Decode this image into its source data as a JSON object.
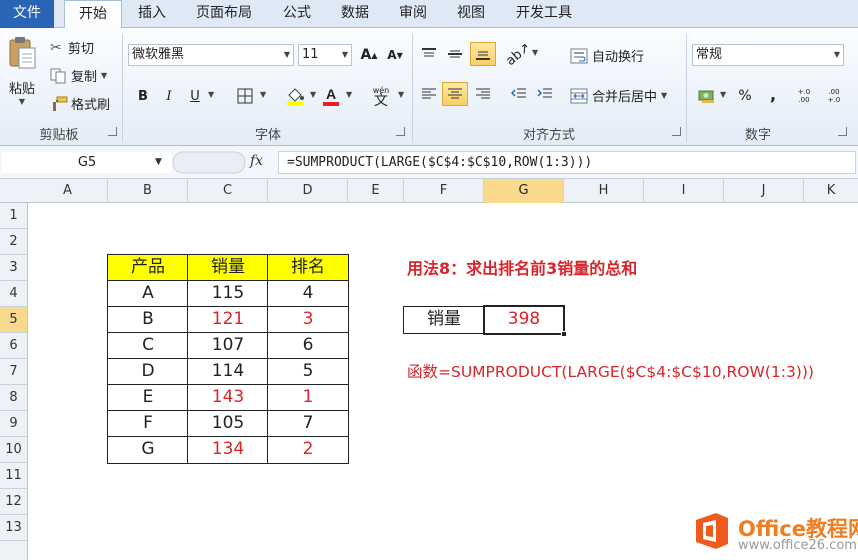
{
  "tabs": [
    "文件",
    "开始",
    "插入",
    "页面布局",
    "公式",
    "数据",
    "审阅",
    "视图",
    "开发工具"
  ],
  "clipboard": {
    "paste": "粘贴",
    "cut": "剪切",
    "copy": "复制",
    "format_painter": "格式刷",
    "label": "剪贴板"
  },
  "font": {
    "name": "微软雅黑",
    "size": "11",
    "grow": "A",
    "shrink": "A",
    "bold": "B",
    "italic": "I",
    "underline": "U",
    "phonetic": "wén",
    "label": "字体"
  },
  "alignment": {
    "wrap": "自动换行",
    "merge": "合并后居中",
    "label": "对齐方式"
  },
  "number": {
    "format": "常规",
    "percent": "%",
    "comma": ",",
    "inc": "+.0 .00",
    "dec": ".00 +.0",
    "label": "数字"
  },
  "formula_bar": {
    "cell": "G5",
    "fx": "fx",
    "formula": "=SUMPRODUCT(LARGE($C$4:$C$10,ROW(1:3)))"
  },
  "columns": [
    "A",
    "B",
    "C",
    "D",
    "E",
    "F",
    "G",
    "H",
    "I",
    "J",
    "K"
  ],
  "rows": [
    "1",
    "2",
    "3",
    "4",
    "5",
    "6",
    "7",
    "8",
    "9",
    "10",
    "11",
    "12",
    "13"
  ],
  "table": {
    "headers": [
      "产品",
      "销量",
      "排名"
    ],
    "rows": [
      [
        "A",
        "115",
        "4"
      ],
      [
        "B",
        "121",
        "3"
      ],
      [
        "C",
        "107",
        "6"
      ],
      [
        "D",
        "114",
        "5"
      ],
      [
        "E",
        "143",
        "1"
      ],
      [
        "F",
        "105",
        "7"
      ],
      [
        "G",
        "134",
        "2"
      ]
    ]
  },
  "title": "用法8：求出排名前3销量的总和",
  "result": {
    "label": "销量",
    "value": "398"
  },
  "function_text": "函数=SUMPRODUCT(LARGE($C$4:$C$10,ROW(1:3)))",
  "watermark": {
    "name": "Office教程网",
    "url": "www.office26.com"
  },
  "colors": {
    "accent": "#d9252b",
    "header_fill": "#ffff00",
    "selection": "#f9d98c",
    "file_tab": "#2a64b4",
    "brand": "#ef7d21"
  }
}
